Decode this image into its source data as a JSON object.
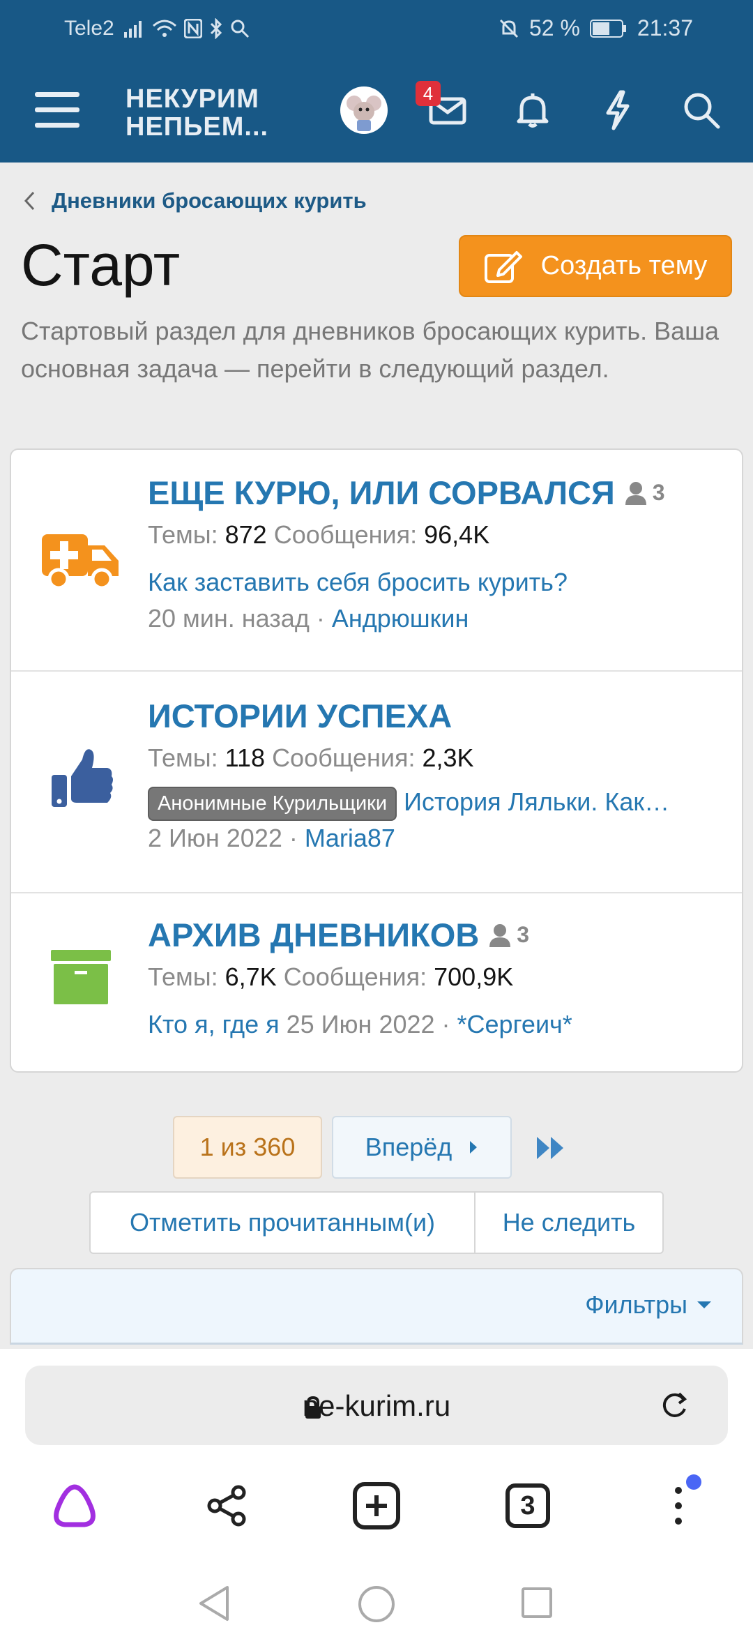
{
  "status_bar": {
    "carrier": "Tele2",
    "battery": "52 %",
    "time": "21:37"
  },
  "header": {
    "logo_line1": "НЕКУРИМ",
    "logo_line2": "НЕПЬЕМ...",
    "messages_badge": "4",
    "icons": [
      "menu-icon",
      "envelope-icon",
      "bell-icon",
      "lightning-icon",
      "search-icon"
    ]
  },
  "breadcrumb": {
    "label": "Дневники бросающих курить"
  },
  "page": {
    "title": "Старт",
    "create_button": "Создать тему",
    "description": "Стартовый раздел для дневников бросающих курить. Ваша основная задача — перейти в следующий раздел."
  },
  "nodes": [
    {
      "title": "ЕЩЕ КУРЮ, ИЛИ СОРВАЛСЯ",
      "viewers": "3",
      "threads_label": "Темы:",
      "threads": "872",
      "messages_label": "Сообщения:",
      "messages": "96,4K",
      "last_thread": "Как заставить себя бросить курить?",
      "last_time": "20 мин. назад",
      "last_user": "Андрюшкин",
      "icon": "ambulance-icon",
      "icon_color": "#f4921d"
    },
    {
      "title": "ИСТОРИИ УСПЕХА",
      "threads_label": "Темы:",
      "threads": "118",
      "messages_label": "Сообщения:",
      "messages": "2,3K",
      "prefix": "Анонимные Курильщики",
      "last_thread": "История Ляльки. Как…",
      "last_time": "2 Июн 2022",
      "last_user": "Maria87",
      "icon": "thumbs-up-icon",
      "icon_color": "#3b5f9e"
    },
    {
      "title": "АРХИВ ДНЕВНИКОВ",
      "viewers": "3",
      "threads_label": "Темы:",
      "threads": "6,7K",
      "messages_label": "Сообщения:",
      "messages": "700,9K",
      "last_thread": "Кто я, где я",
      "last_time": "25 Июн 2022",
      "last_user": "*Сергеич*",
      "icon": "archive-box-icon",
      "icon_color": "#7bbf47"
    }
  ],
  "pagination": {
    "current": "1 из 360",
    "next": "Вперёд"
  },
  "actions": {
    "mark_read": "Отметить прочитанным(и)",
    "unwatch": "Не следить"
  },
  "filters": {
    "label": "Фильтры"
  },
  "browser": {
    "url": "ne-kurim.ru",
    "tab_count": "3"
  }
}
